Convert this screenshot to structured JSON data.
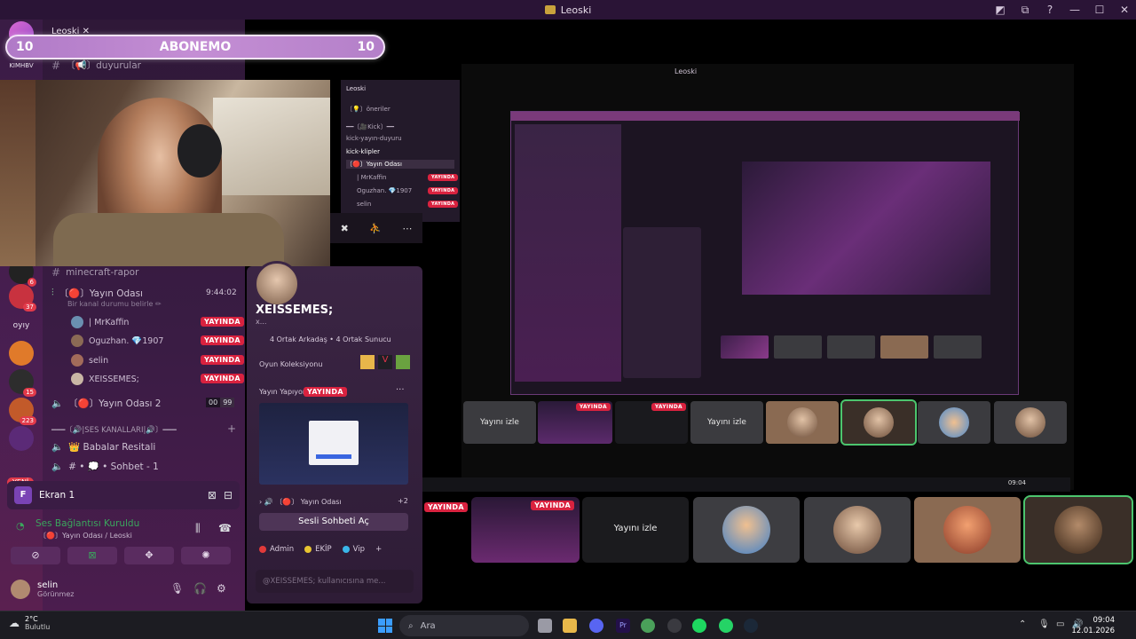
{
  "window": {
    "title": "Leoski",
    "controls": [
      "◩",
      "⧉",
      "?",
      "—",
      "☐",
      "✕"
    ]
  },
  "abonemo": {
    "left_count": "10",
    "label": "ABONEMO",
    "right_count": "10"
  },
  "server": {
    "name": "Leoski",
    "name_suffix": "✕"
  },
  "rail": {
    "top_label": "KIMHBV",
    "badges": [
      "6",
      "37",
      "15",
      "223"
    ],
    "oyun_label": "oyıy",
    "new_label": "YENİ"
  },
  "channels": {
    "duyurular": "〔📢〕duyurular",
    "minecraft": "minecraft-rapor",
    "yayin_odasi": "〔🔴〕Yayın Odası",
    "yayin_time": "9:44:02",
    "status_hint": "Bir kanal durumu belirle ✏",
    "members": [
      {
        "name": "| MrKaffin",
        "live": "YAYINDA"
      },
      {
        "name": "Oguzhan. 💎1907",
        "live": "YAYINDA"
      },
      {
        "name": "selin",
        "live": "YAYINDA"
      },
      {
        "name": "XEISSEMES;",
        "live": "YAYINDA"
      }
    ],
    "yayin_odasi_2": "〔🔴〕Yayın Odası 2",
    "y2_count_a": "00",
    "y2_count_b": "99",
    "ses_kanallari": "━━━〔🔊|SES KANALLARI|🔊〕━━━",
    "babalar": "👑 Babalar Resitali",
    "sohbet": "# • 💭 • Sohbet - 1"
  },
  "ekran": {
    "label": "Ekran 1"
  },
  "voice": {
    "status": "Ses Bağlantısı Kuruldu",
    "location": "〔🔴〕Yayın Odası / Leoski"
  },
  "user": {
    "name": "selin",
    "status": "Görünmez"
  },
  "profile": {
    "name": "XEISSEMES;",
    "tag": "x...",
    "mutuals": "4 Ortak Arkadaş • 4 Ortak Sunucu",
    "collection": "Oyun Koleksiyonu",
    "streaming": "Yayın Yapıyor",
    "live": "YAYINDA",
    "more": "···",
    "channel_line": "› 🔊 〔🔴〕 Yayın Odası",
    "plus_count": "+2",
    "open_chat": "Sesli Sohbeti Aç",
    "roles": [
      {
        "name": "Admin",
        "color": "#e23a3a"
      },
      {
        "name": "EKİP",
        "color": "#e8c531"
      },
      {
        "name": "Vip",
        "color": "#3ab6e8"
      }
    ],
    "message_placeholder": "@XEISSEMES; kullanıcısına me..."
  },
  "nested": {
    "server": "Leoski",
    "rows": [
      "〔💡〕öneriler",
      "━━〔🎥Kick〕━━",
      "kick-yayın-duyuru",
      "kick-klipler",
      "〔🔴〕Yayın Odası",
      "| MrKaffin",
      "Oguzhan. 💎1907",
      "selin"
    ],
    "live": "YAYINDA",
    "stage_title": "Leoski"
  },
  "tiles": {
    "watch_label": "Yayını izle",
    "live": "YAYINDA"
  },
  "taskbar": {
    "temp": "2°C",
    "weather": "Bulutlu",
    "search": "Ara",
    "time": "09:04",
    "date": "12.01.2026"
  }
}
